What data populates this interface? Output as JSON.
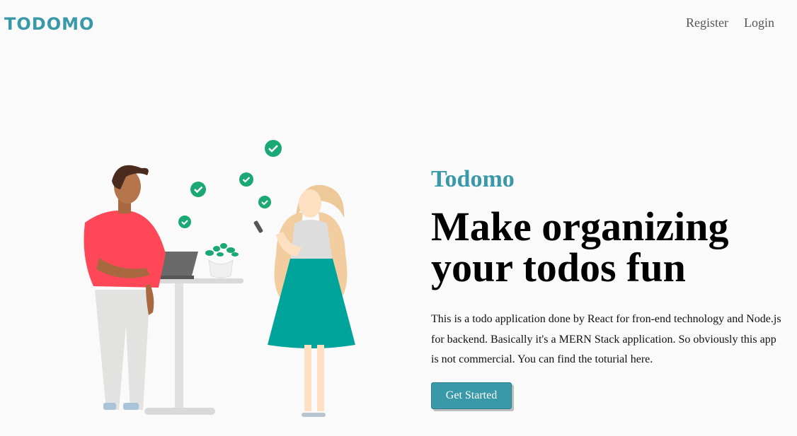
{
  "header": {
    "logo": "TODOMO",
    "nav": {
      "register": "Register",
      "login": "Login"
    }
  },
  "hero": {
    "brand": "Todomo",
    "headline_line1": "Make organizing",
    "headline_line2": "your todos fun",
    "description": "This is a todo application done by React for fron-end technology and Node.js for backend. Basically it's a MERN Stack application. So obviously this app is not commercial. You can find the toturial here.",
    "cta_label": "Get Started"
  },
  "colors": {
    "accent": "#3999a8",
    "check_green": "#1aa874"
  }
}
